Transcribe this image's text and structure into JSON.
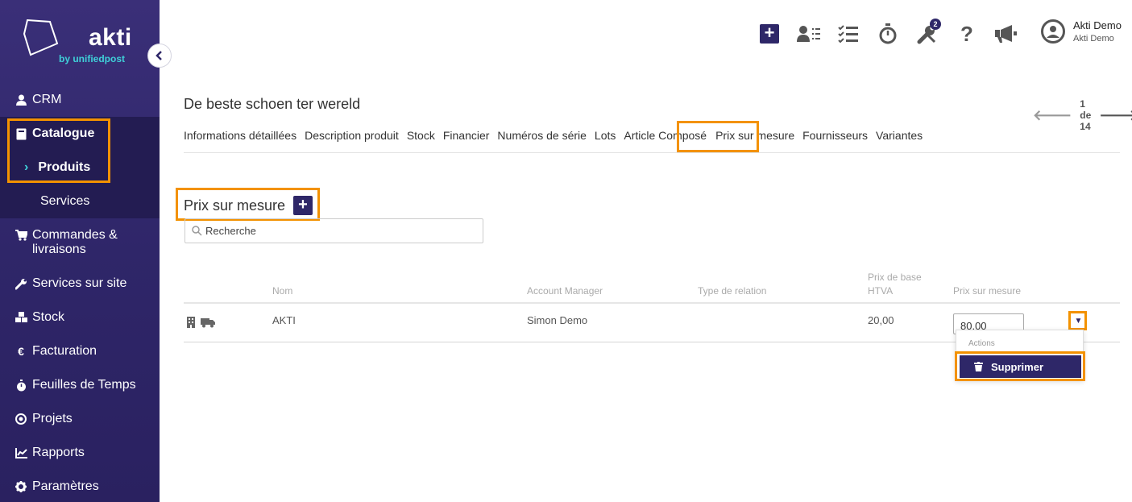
{
  "app": {
    "brand": "akti",
    "brand_sub": "by unifiedpost"
  },
  "colors": {
    "sidebar": "#2f2669",
    "accent": "#2e2768",
    "highlight": "#f39200",
    "brand_teal": "#3fd0d9"
  },
  "sidebar": {
    "items": [
      {
        "label": "CRM",
        "icon": "user-icon"
      },
      {
        "label": "Catalogue",
        "icon": "book-icon"
      },
      {
        "label": "Produits"
      },
      {
        "label": "Services"
      },
      {
        "label": "Commandes & livraisons",
        "icon": "cart-icon"
      },
      {
        "label": "Services sur site",
        "icon": "wrench-icon"
      },
      {
        "label": "Stock",
        "icon": "boxes-icon"
      },
      {
        "label": "Facturation",
        "icon": "euro-icon"
      },
      {
        "label": "Feuilles de Temps",
        "icon": "stopwatch-icon"
      },
      {
        "label": "Projets",
        "icon": "target-icon"
      },
      {
        "label": "Rapports",
        "icon": "chart-icon"
      },
      {
        "label": "Paramètres",
        "icon": "gear-icon"
      }
    ]
  },
  "topbar": {
    "icons": [
      "add-icon",
      "contacts-list-icon",
      "checklist-icon",
      "stopwatch-icon",
      "tools-icon",
      "help-icon",
      "megaphone-icon"
    ],
    "tools_badge": "2",
    "user_name": "Akti Demo",
    "user_company": "Akti Demo"
  },
  "product": {
    "title": "De beste schoen ter wereld",
    "pager": "1 de 14"
  },
  "tabs": [
    "Informations détaillées",
    "Description produit",
    "Stock",
    "Financier",
    "Numéros de série",
    "Lots",
    "Article Composé",
    "Prix sur mesure",
    "Fournisseurs",
    "Variantes"
  ],
  "section": {
    "title": "Prix sur mesure",
    "search_placeholder": "Recherche"
  },
  "table": {
    "headers": {
      "nom": "Nom",
      "account_manager": "Account Manager",
      "type_relation": "Type de relation",
      "prix_base_1": "Prix de base",
      "prix_base_2": "HTVA",
      "prix_mesure": "Prix sur mesure"
    },
    "rows": [
      {
        "nom": "AKTI",
        "account_manager": "Simon Demo",
        "type_relation": "",
        "prix_base": "20,00",
        "prix_mesure": "80,00"
      }
    ]
  },
  "dropdown": {
    "header": "Actions",
    "delete_label": "Supprimer"
  }
}
